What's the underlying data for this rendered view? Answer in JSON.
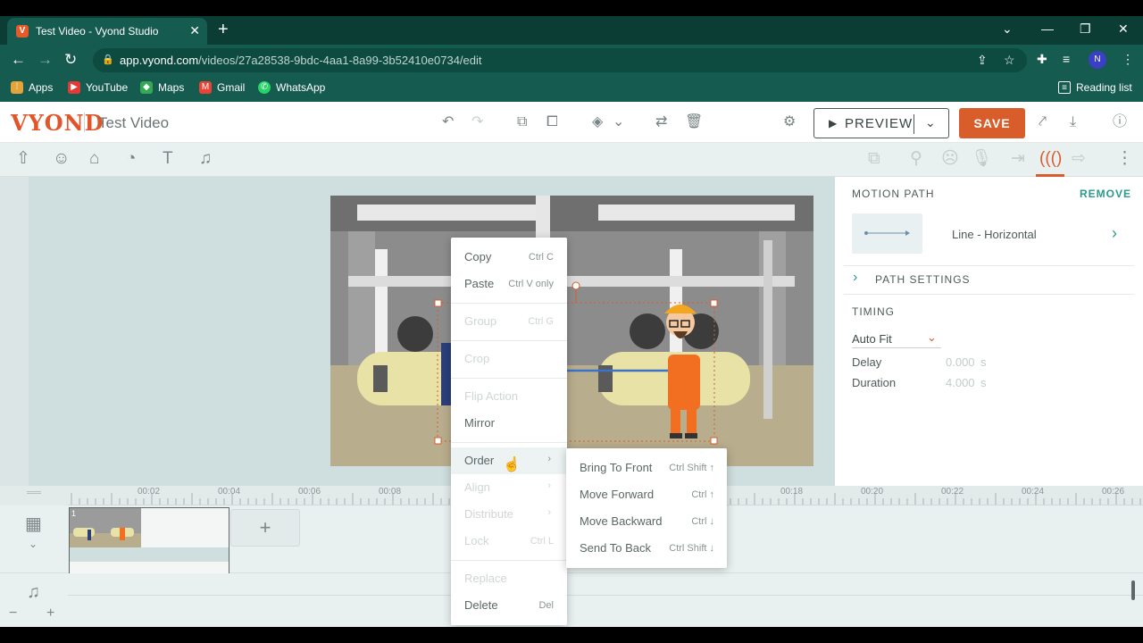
{
  "browser": {
    "tab_title": "Test Video - Vyond Studio",
    "tab_favicon": "V",
    "url_host": "app.vyond.com",
    "url_path": "/videos/27a28538-9bdc-4aa1-8a99-3b52410e0734/edit",
    "profile_initials": "N",
    "bookmarks": [
      "Apps",
      "YouTube",
      "Maps",
      "Gmail",
      "WhatsApp"
    ],
    "reading_list": "Reading list"
  },
  "app": {
    "logo": "VYOND",
    "project_title": "Test Video",
    "preview_label": "PREVIEW",
    "save_label": "SAVE",
    "accent_color": "#d95c2b"
  },
  "panel": {
    "motion_path_heading": "MOTION PATH",
    "remove_label": "REMOVE",
    "path_type": "Line - Horizontal",
    "path_settings_label": "PATH SETTINGS",
    "timing_heading": "TIMING",
    "timing_mode": "Auto Fit",
    "delay_label": "Delay",
    "delay_value": "0.000",
    "delay_unit": "s",
    "duration_label": "Duration",
    "duration_value": "4.000",
    "duration_unit": "s"
  },
  "timeline": {
    "ticks": [
      "00:02",
      "00:04",
      "00:06",
      "00:08",
      "00:18",
      "00:20",
      "00:22",
      "00:24",
      "00:26"
    ],
    "scene_number": "1"
  },
  "context_menu": {
    "items": [
      {
        "label": "Copy",
        "shortcut": "Ctrl C",
        "disabled": false
      },
      {
        "label": "Paste",
        "shortcut": "Ctrl V only",
        "disabled": false
      },
      {
        "label": "Group",
        "shortcut": "Ctrl G",
        "disabled": true
      },
      {
        "label": "Crop",
        "shortcut": "",
        "disabled": true
      },
      {
        "label": "Flip Action",
        "shortcut": "",
        "disabled": true
      },
      {
        "label": "Mirror",
        "shortcut": "",
        "disabled": false
      },
      {
        "label": "Order",
        "shortcut": "",
        "disabled": false
      },
      {
        "label": "Align",
        "shortcut": "",
        "disabled": true
      },
      {
        "label": "Distribute",
        "shortcut": "",
        "disabled": true
      },
      {
        "label": "Lock",
        "shortcut": "Ctrl L",
        "disabled": true
      },
      {
        "label": "Replace",
        "shortcut": "",
        "disabled": true
      },
      {
        "label": "Delete",
        "shortcut": "Del",
        "disabled": false
      }
    ]
  },
  "order_submenu": {
    "items": [
      {
        "label": "Bring To Front",
        "shortcut": "Ctrl Shift ↑"
      },
      {
        "label": "Move Forward",
        "shortcut": "Ctrl ↑"
      },
      {
        "label": "Move Backward",
        "shortcut": "Ctrl ↓"
      },
      {
        "label": "Send To Back",
        "shortcut": "Ctrl Shift ↓"
      }
    ]
  }
}
